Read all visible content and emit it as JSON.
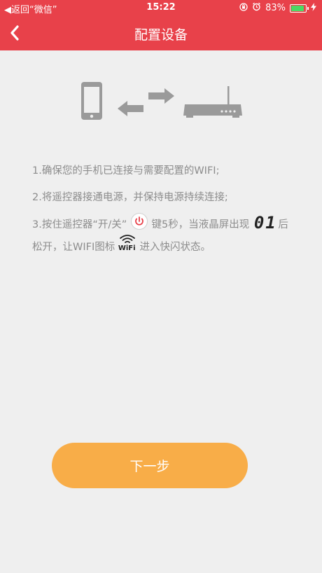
{
  "statusbar": {
    "back_label": "◀返回“微信”",
    "time": "15:22",
    "battery_text": "83%"
  },
  "navbar": {
    "title": "配置设备"
  },
  "instructions": {
    "step1": "1.确保您的手机已连接与需要配置的WIFI;",
    "step2": "2.将遥控器接通电源，并保持电源持续连接;",
    "step3_part1": "3.按住遥控器“开/关”",
    "step3_part2": "键5秒，当液晶屏出现",
    "step3_part3": "后",
    "step3_line2_part1": "松开，让WIFI图标",
    "step3_line2_part2": "进入快闪状态。",
    "lcd_display": "01",
    "wifi_icon_label": "WiFi"
  },
  "next_button": {
    "label": "下一步"
  },
  "colors": {
    "brand_red": "#e8414a",
    "button_orange": "#f8ad48",
    "text_gray": "#8c8c8c",
    "icon_gray": "#9a9a9a"
  },
  "icons": [
    "phone-icon",
    "arrow-left-icon",
    "arrow-right-icon",
    "router-icon",
    "power-icon",
    "lcd-display-icon",
    "wifi-icon"
  ]
}
